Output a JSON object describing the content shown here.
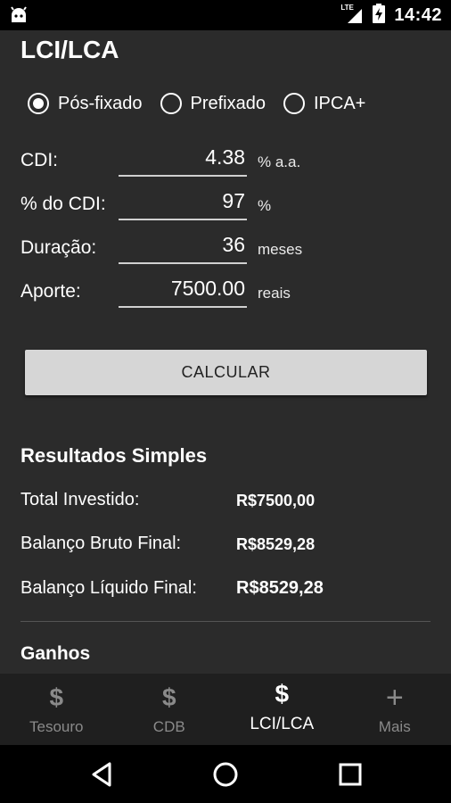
{
  "status_bar": {
    "network_label": "LTE",
    "time": "14:42",
    "icons": [
      "android-debug-icon",
      "signal-icon",
      "battery-charging-icon"
    ]
  },
  "app_title": "LCI/LCA",
  "rate_type": {
    "options": [
      "Pós-fixado",
      "Prefixado",
      "IPCA+"
    ],
    "selected": "Pós-fixado"
  },
  "form": {
    "cdi": {
      "label": "CDI:",
      "value": "4.38",
      "unit": "% a.a."
    },
    "percent_cdi": {
      "label": "% do CDI:",
      "value": "97",
      "unit": "%"
    },
    "duration": {
      "label": "Duração:",
      "value": "36",
      "unit": "meses"
    },
    "contribution": {
      "label": "Aporte:",
      "value": "7500.00",
      "unit": "reais"
    }
  },
  "calculate_label": "CALCULAR",
  "results": {
    "title": "Resultados Simples",
    "rows": [
      {
        "label": "Total Investido:",
        "value": "R$7500,00"
      },
      {
        "label": "Balanço Bruto Final:",
        "value": "R$8529,28"
      },
      {
        "label": "Balanço Líquido Final:",
        "value": "R$8529,28"
      }
    ]
  },
  "gains_title": "Ganhos",
  "bottom_nav": {
    "items": [
      {
        "label": "Tesouro",
        "icon": "dollar-icon"
      },
      {
        "label": "CDB",
        "icon": "dollar-icon"
      },
      {
        "label": "LCI/LCA",
        "icon": "dollar-icon"
      },
      {
        "label": "Mais",
        "icon": "plus-icon"
      }
    ],
    "active": "LCI/LCA"
  },
  "colors": {
    "background": "#2b2b2b",
    "nav_background": "#1f1f1f",
    "button": "#d6d6d6",
    "inactive_nav": "#8a8a8a"
  }
}
